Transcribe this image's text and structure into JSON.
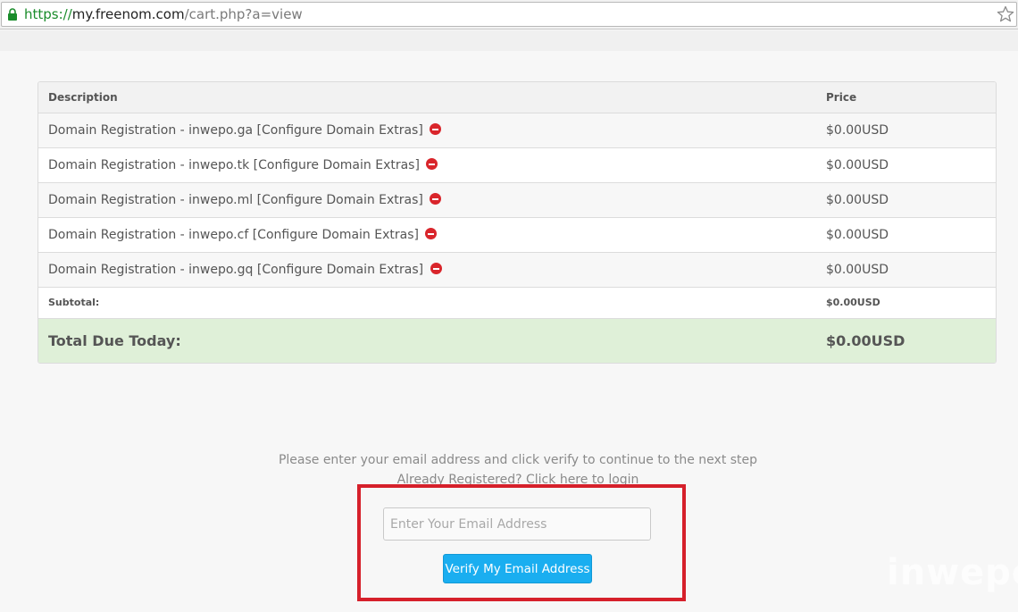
{
  "browser": {
    "url_scheme": "https://",
    "url_host": "my.freenom.com",
    "url_path": "/cart.php?a=view"
  },
  "cart": {
    "columns": {
      "description": "Description",
      "price": "Price"
    },
    "items": [
      {
        "description": "Domain Registration - inwepo.ga [Configure Domain Extras]",
        "price": "$0.00USD"
      },
      {
        "description": "Domain Registration - inwepo.tk [Configure Domain Extras]",
        "price": "$0.00USD"
      },
      {
        "description": "Domain Registration - inwepo.ml [Configure Domain Extras]",
        "price": "$0.00USD"
      },
      {
        "description": "Domain Registration - inwepo.cf [Configure Domain Extras]",
        "price": "$0.00USD"
      },
      {
        "description": "Domain Registration - inwepo.gq [Configure Domain Extras]",
        "price": "$0.00USD"
      }
    ],
    "subtotal_label": "Subtotal:",
    "subtotal_value": "$0.00USD",
    "total_label": "Total Due Today:",
    "total_value": "$0.00USD"
  },
  "verify": {
    "prompt": "Please enter your email address and click verify to continue to the next step",
    "login_text": "Already Registered? Click here to login",
    "email_placeholder": "Enter Your Email Address",
    "button_label": "Verify My Email Address"
  },
  "watermark": "inwepo",
  "colors": {
    "total_bg": "#dff0d8",
    "button_bg": "#1aaef0",
    "highlight": "#d6202b",
    "remove_icon": "#d9252b",
    "url_scheme": "#1a8c2b"
  }
}
